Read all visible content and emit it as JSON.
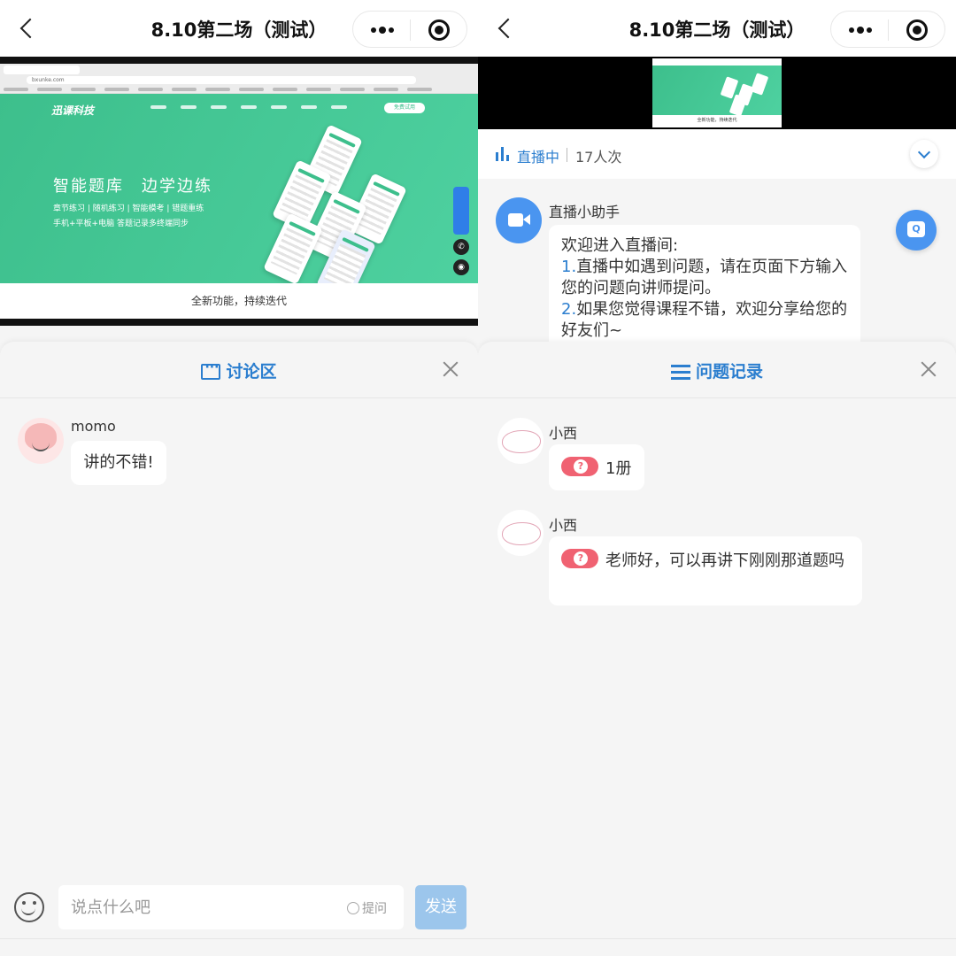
{
  "colors": {
    "accent": "#2b7ecf",
    "send_disabled": "#9cc6ec",
    "question_tag": "#f06272",
    "site_green": "#3dbf8c"
  },
  "left": {
    "topbar": {
      "title": "8.10第二场（测试）"
    },
    "video": {
      "url": "bxunke.com",
      "site_logo": "迅课科技",
      "site_button": "免费试用",
      "headline": "智能题库　边学边练",
      "subline1": "章节练习 | 随机练习 | 智能模考 | 错题重练",
      "subline2": "手机+平板+电脑 答题记录多终端同步",
      "footer": "全新功能，持续迭代"
    },
    "sheet": {
      "title": "讨论区"
    },
    "messages": [
      {
        "name": "momo",
        "text": "讲的不错!"
      }
    ],
    "composer": {
      "placeholder": "说点什么吧",
      "ask_label": "提问",
      "send_label": "发送"
    }
  },
  "right": {
    "topbar": {
      "title": "8.10第二场（测试）"
    },
    "live": {
      "status": "直播中",
      "viewers": "17人次"
    },
    "assistant": {
      "name": "直播小助手",
      "line1": "欢迎进入直播间:",
      "n1": "1.",
      "line2": "直播中如遇到问题，请在页面下方输入您的问题向讲师提问。",
      "n2": "2.",
      "line3": "如果您觉得课程不错，欢迎分享给您的好友们~"
    },
    "float_button": "Q",
    "sheet": {
      "title": "问题记录"
    },
    "questions": [
      {
        "name": "小西",
        "text": "1册"
      },
      {
        "name": "小西",
        "text": "老师好，可以再讲下刚刚那道题吗"
      }
    ]
  }
}
